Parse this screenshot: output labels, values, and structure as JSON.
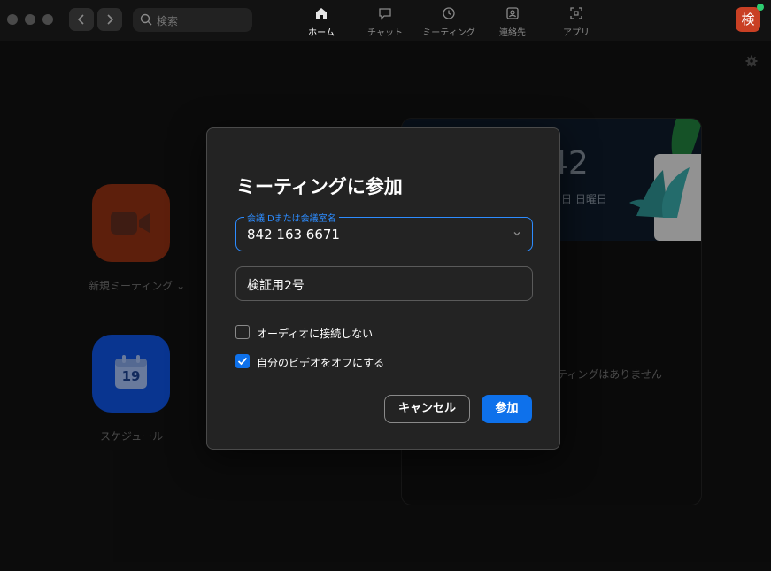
{
  "search": {
    "placeholder": "検索"
  },
  "nav_tabs": [
    {
      "label": "ホーム",
      "icon": "home-icon",
      "active": true
    },
    {
      "label": "チャット",
      "icon": "chat-icon",
      "active": false
    },
    {
      "label": "ミーティング",
      "icon": "clock-icon",
      "active": false
    },
    {
      "label": "連絡先",
      "icon": "contacts-icon",
      "active": false
    },
    {
      "label": "アプリ",
      "icon": "apps-icon",
      "active": false
    }
  ],
  "user": {
    "avatar_text": "検"
  },
  "home": {
    "new_meeting_label": "新規ミーティング ⌄",
    "schedule_label": "スケジュール",
    "calendar_day": "19",
    "clock_partial": "42",
    "date_partial": "日 日曜日",
    "no_meetings_partial": "ティングはありません"
  },
  "dialog": {
    "title": "ミーティングに参加",
    "meeting_id_label": "会議IDまたは会議室名",
    "meeting_id_value": "842 163 6671",
    "name_value": "検証用2号",
    "options": [
      {
        "label": "オーディオに接続しない",
        "checked": false
      },
      {
        "label": "自分のビデオをオフにする",
        "checked": true
      }
    ],
    "cancel_label": "キャンセル",
    "join_label": "参加"
  },
  "colors": {
    "accent": "#0e71eb",
    "field_focus": "#2d8cff",
    "avatar": "#c94024",
    "presence": "#2ecc71"
  }
}
